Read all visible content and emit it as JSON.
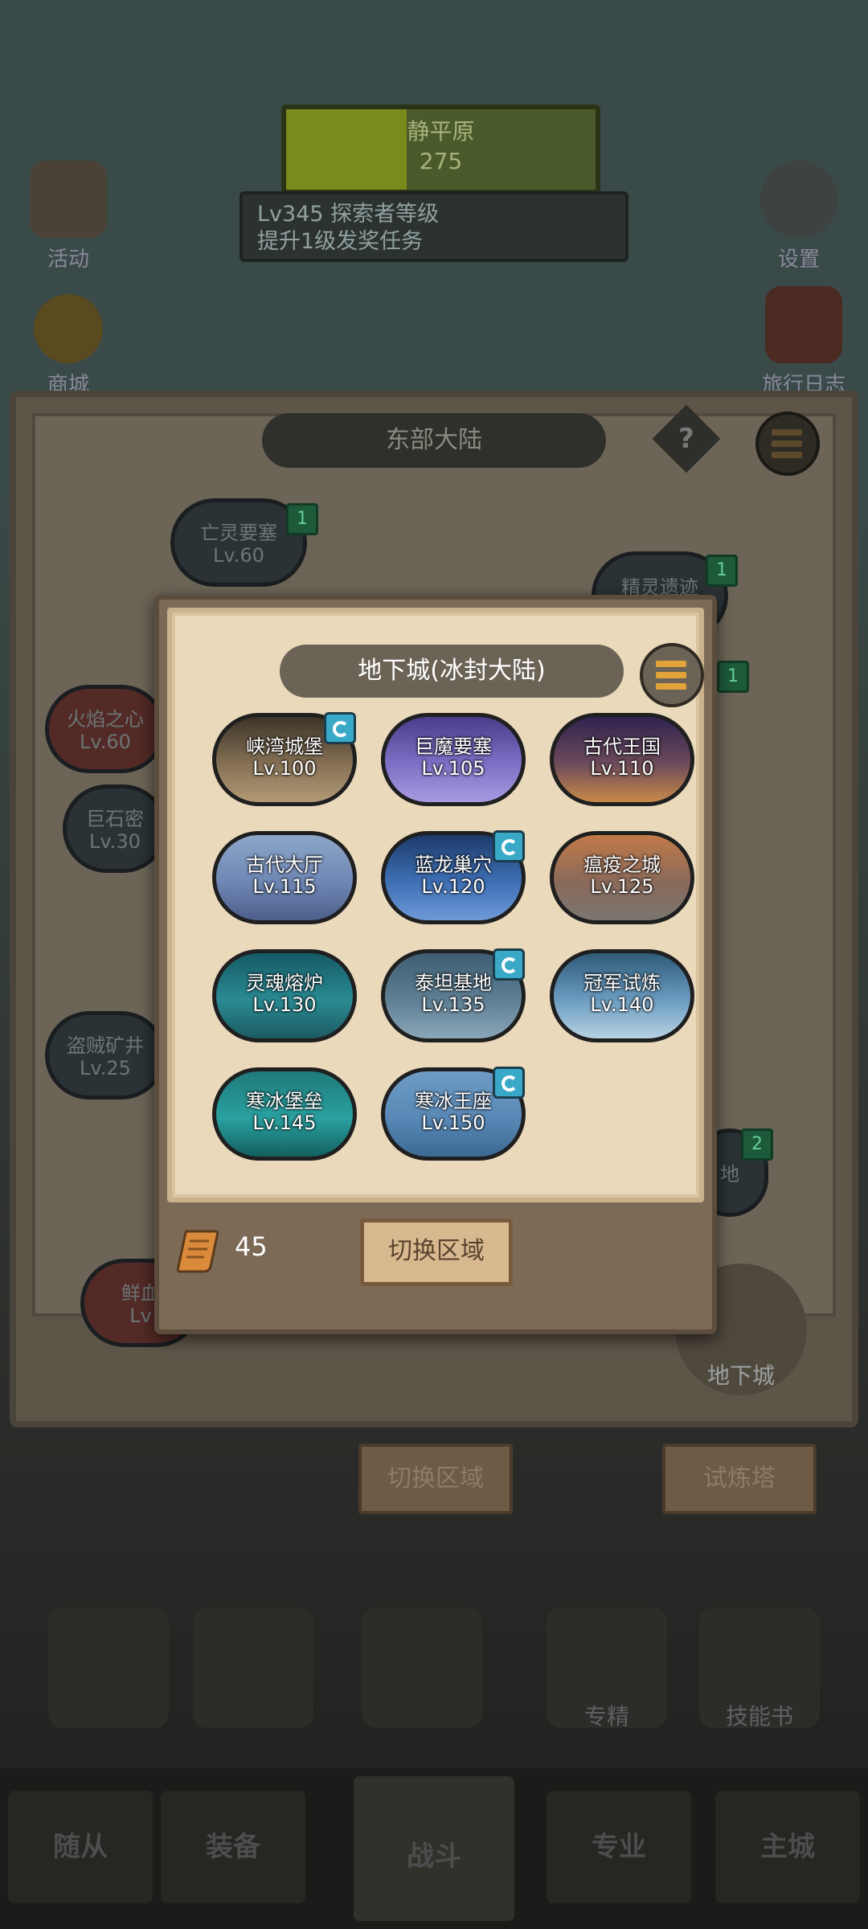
{
  "hud": {
    "progress_title": "静平原",
    "progress_value": "275",
    "quest_text": "Lv345 探索者等级",
    "quest_text_2": "提升1级发奖任务"
  },
  "side": {
    "left_top": "活动",
    "left_coin": "商城",
    "right_settings": "设置",
    "right_chest": "旅行日志"
  },
  "map": {
    "title": "东部大陆",
    "help": "?",
    "nodes": [
      {
        "name": "亡灵要塞",
        "level": "Lv.60",
        "badge": "1"
      },
      {
        "name": "精灵遗迹",
        "badge": "1"
      },
      {
        "name": "火焰之心",
        "level": "Lv.60"
      },
      {
        "name": "巨石密",
        "level": "Lv.30"
      },
      {
        "name": "盗贼矿井",
        "level": "Lv.25"
      },
      {
        "name": "鲜血",
        "level": "Lv"
      },
      {
        "badge": "1"
      },
      {
        "name": "地",
        "badge": "2"
      }
    ],
    "switch_region": "切换区域",
    "trial_tower": "试炼塔",
    "dungeon": "地下城"
  },
  "skills": {
    "enchant": "专精",
    "skill_book": "技能书"
  },
  "nav": {
    "followers": "随从",
    "equipment": "装备",
    "battle": "战斗",
    "profession": "专业",
    "main_city": "主城"
  },
  "dialog": {
    "title": "地下城(冰封大陆)",
    "dungeons": [
      {
        "name": "峡湾城堡",
        "level": "Lv.100",
        "icon": true
      },
      {
        "name": "巨魔要塞",
        "level": "Lv.105",
        "icon": false
      },
      {
        "name": "古代王国",
        "level": "Lv.110",
        "icon": false
      },
      {
        "name": "古代大厅",
        "level": "Lv.115",
        "icon": false
      },
      {
        "name": "蓝龙巢穴",
        "level": "Lv.120",
        "icon": true
      },
      {
        "name": "瘟疫之城",
        "level": "Lv.125",
        "icon": false
      },
      {
        "name": "灵魂熔炉",
        "level": "Lv.130",
        "icon": false
      },
      {
        "name": "泰坦基地",
        "level": "Lv.135",
        "icon": true
      },
      {
        "name": "冠军试炼",
        "level": "Lv.140",
        "icon": false
      },
      {
        "name": "寒冰堡垒",
        "level": "Lv.145",
        "icon": false
      },
      {
        "name": "寒冰王座",
        "level": "Lv.150",
        "icon": true
      }
    ],
    "scroll_count": "45",
    "switch_region": "切换区域",
    "colors": {
      "parchment": "#ead9bb",
      "frame": "#7c6a57",
      "title_bg": "#6a6356",
      "button_bg": "#d8b98f"
    }
  }
}
